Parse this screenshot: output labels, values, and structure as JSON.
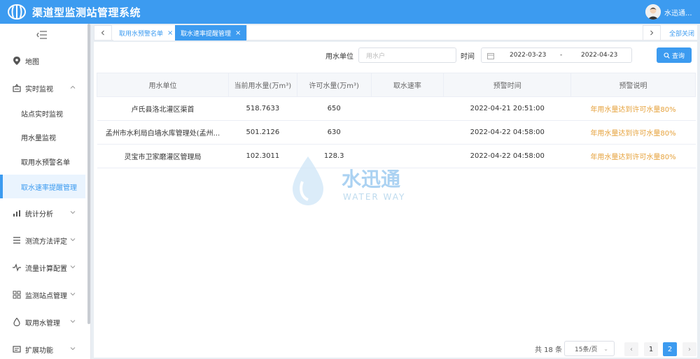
{
  "header": {
    "title": "渠道型监测站管理系统",
    "user_name": "水迅通..."
  },
  "sidebar": {
    "items": [
      {
        "label": "地图",
        "icon": "map-pin-icon"
      },
      {
        "label": "实时监视",
        "icon": "monitor-icon",
        "expanded": true
      },
      {
        "label": "统计分析",
        "icon": "bar-chart-icon"
      },
      {
        "label": "测流方法评定",
        "icon": "list-icon"
      },
      {
        "label": "流量计算配置",
        "icon": "pulse-icon"
      },
      {
        "label": "监测站点管理",
        "icon": "grid-icon"
      },
      {
        "label": "取用水管理",
        "icon": "water-drop-icon"
      },
      {
        "label": "扩展功能",
        "icon": "extension-icon"
      }
    ],
    "sub_items": [
      {
        "label": "站点实时监视"
      },
      {
        "label": "用水量监视"
      },
      {
        "label": "取用水预警名单"
      },
      {
        "label": "取水速率提醒管理",
        "active": true
      }
    ]
  },
  "tabs": {
    "items": [
      {
        "label": "取用水预警名单"
      },
      {
        "label": "取水速率提醒管理",
        "active": true
      }
    ],
    "close_all": "全部关闭"
  },
  "filters": {
    "unit_label": "用水单位",
    "unit_placeholder": "用水户",
    "time_label": "时间",
    "start_date": "2022-03-23",
    "date_separator": "-",
    "end_date": "2022-04-23",
    "query_label": "查询"
  },
  "table": {
    "headers": [
      "用水单位",
      "当前用水量(万m³)",
      "许可水量(万m³)",
      "取水速率",
      "预警时间",
      "预警说明"
    ],
    "rows": [
      {
        "unit": "卢氏县洛北灌区渠首",
        "current": "518.7633",
        "permit": "650",
        "rate": "",
        "time": "2022-04-21 20:51:00",
        "note": "年用水量达到许可水量80%"
      },
      {
        "unit": "孟州市水利局白墙水库管理处(孟州...",
        "current": "501.2126",
        "permit": "630",
        "rate": "",
        "time": "2022-04-22 04:58:00",
        "note": "年用水量达到许可水量80%"
      },
      {
        "unit": "灵宝市卫家磨灌区管理局",
        "current": "102.3011",
        "permit": "128.3",
        "rate": "",
        "time": "2022-04-22 04:58:00",
        "note": "年用水量达到许可水量80%"
      }
    ]
  },
  "watermark": {
    "text_cn": "水迅通",
    "text_en": "WATER WAY"
  },
  "pagination": {
    "total": "共 18 条",
    "page_size": "15条/页",
    "pages": [
      "1",
      "2"
    ],
    "current_page": "2"
  },
  "colors": {
    "primary": "#3c9bf0",
    "warning": "#e6a23c"
  }
}
